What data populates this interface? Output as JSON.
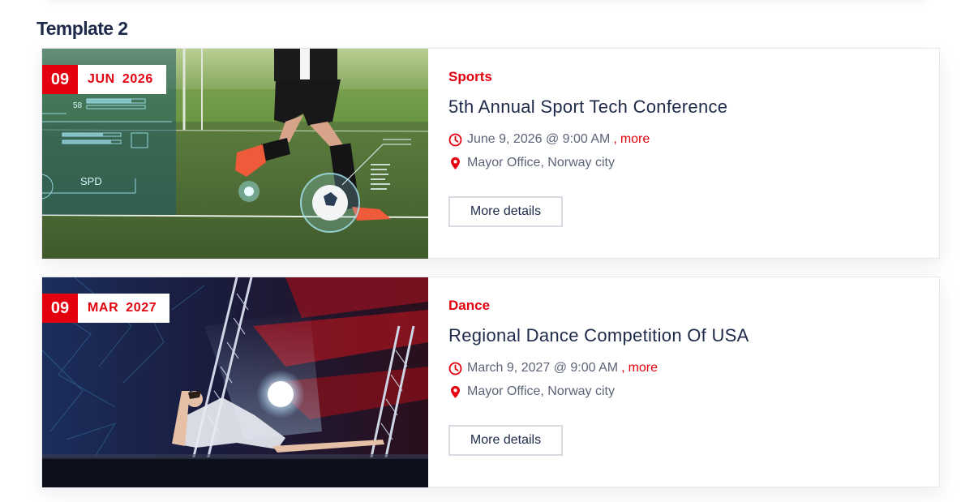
{
  "section": {
    "title": "Template 2"
  },
  "colors": {
    "accent": "#e3000f",
    "title": "#1e2a4a",
    "meta": "#5c6478",
    "border": "#e6e8ec"
  },
  "events": [
    {
      "image": "soccer-player-hud",
      "day": "09",
      "month_year": "JUN  2026",
      "category": "Sports",
      "title": "5th Annual Sport Tech Conference",
      "time_icon": "clock-icon",
      "datetime": "June 9, 2026 @ 9:00 AM",
      "separator": ",",
      "more_link": "more",
      "location_icon": "map-pin-icon",
      "location": "Mayor Office, Norway city",
      "button_label": "More details",
      "hud_label": "SPD",
      "hud_number": "58"
    },
    {
      "image": "stage-dancer",
      "day": "09",
      "month_year": "MAR  2027",
      "category": "Dance",
      "title": "Regional Dance Competition Of USA",
      "time_icon": "clock-icon",
      "datetime": "March 9, 2027 @ 9:00 AM",
      "separator": ",",
      "more_link": "more",
      "location_icon": "map-pin-icon",
      "location": "Mayor Office, Norway city",
      "button_label": "More details"
    }
  ]
}
